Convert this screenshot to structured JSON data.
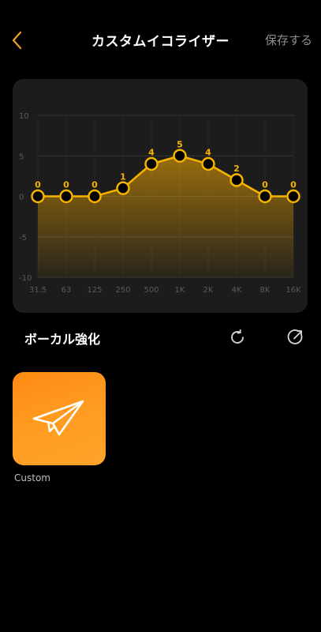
{
  "header": {
    "title": "カスタムイコライザー",
    "save_label": "保存する"
  },
  "chart_data": {
    "type": "line",
    "x": [
      "31.5",
      "63",
      "125",
      "250",
      "500",
      "1K",
      "2K",
      "4K",
      "8K",
      "16K"
    ],
    "series": [
      {
        "values": [
          0,
          0,
          0,
          1,
          4,
          5,
          4,
          2,
          0,
          0
        ]
      }
    ],
    "ylim": [
      -10,
      10
    ],
    "yticks": [
      "10",
      "5",
      "0",
      "-5",
      "-10"
    ],
    "grid": true,
    "colors": {
      "line": "#f5b300",
      "point_fill": "#000000",
      "label": "#f5b300",
      "fill": "#ffb000"
    }
  },
  "preset": {
    "name": "ボーカル強化"
  },
  "custom_presets": [
    {
      "label": "Custom"
    }
  ],
  "colors": {
    "accent": "#ff9a1f",
    "back_arrow": "#f0a020"
  }
}
